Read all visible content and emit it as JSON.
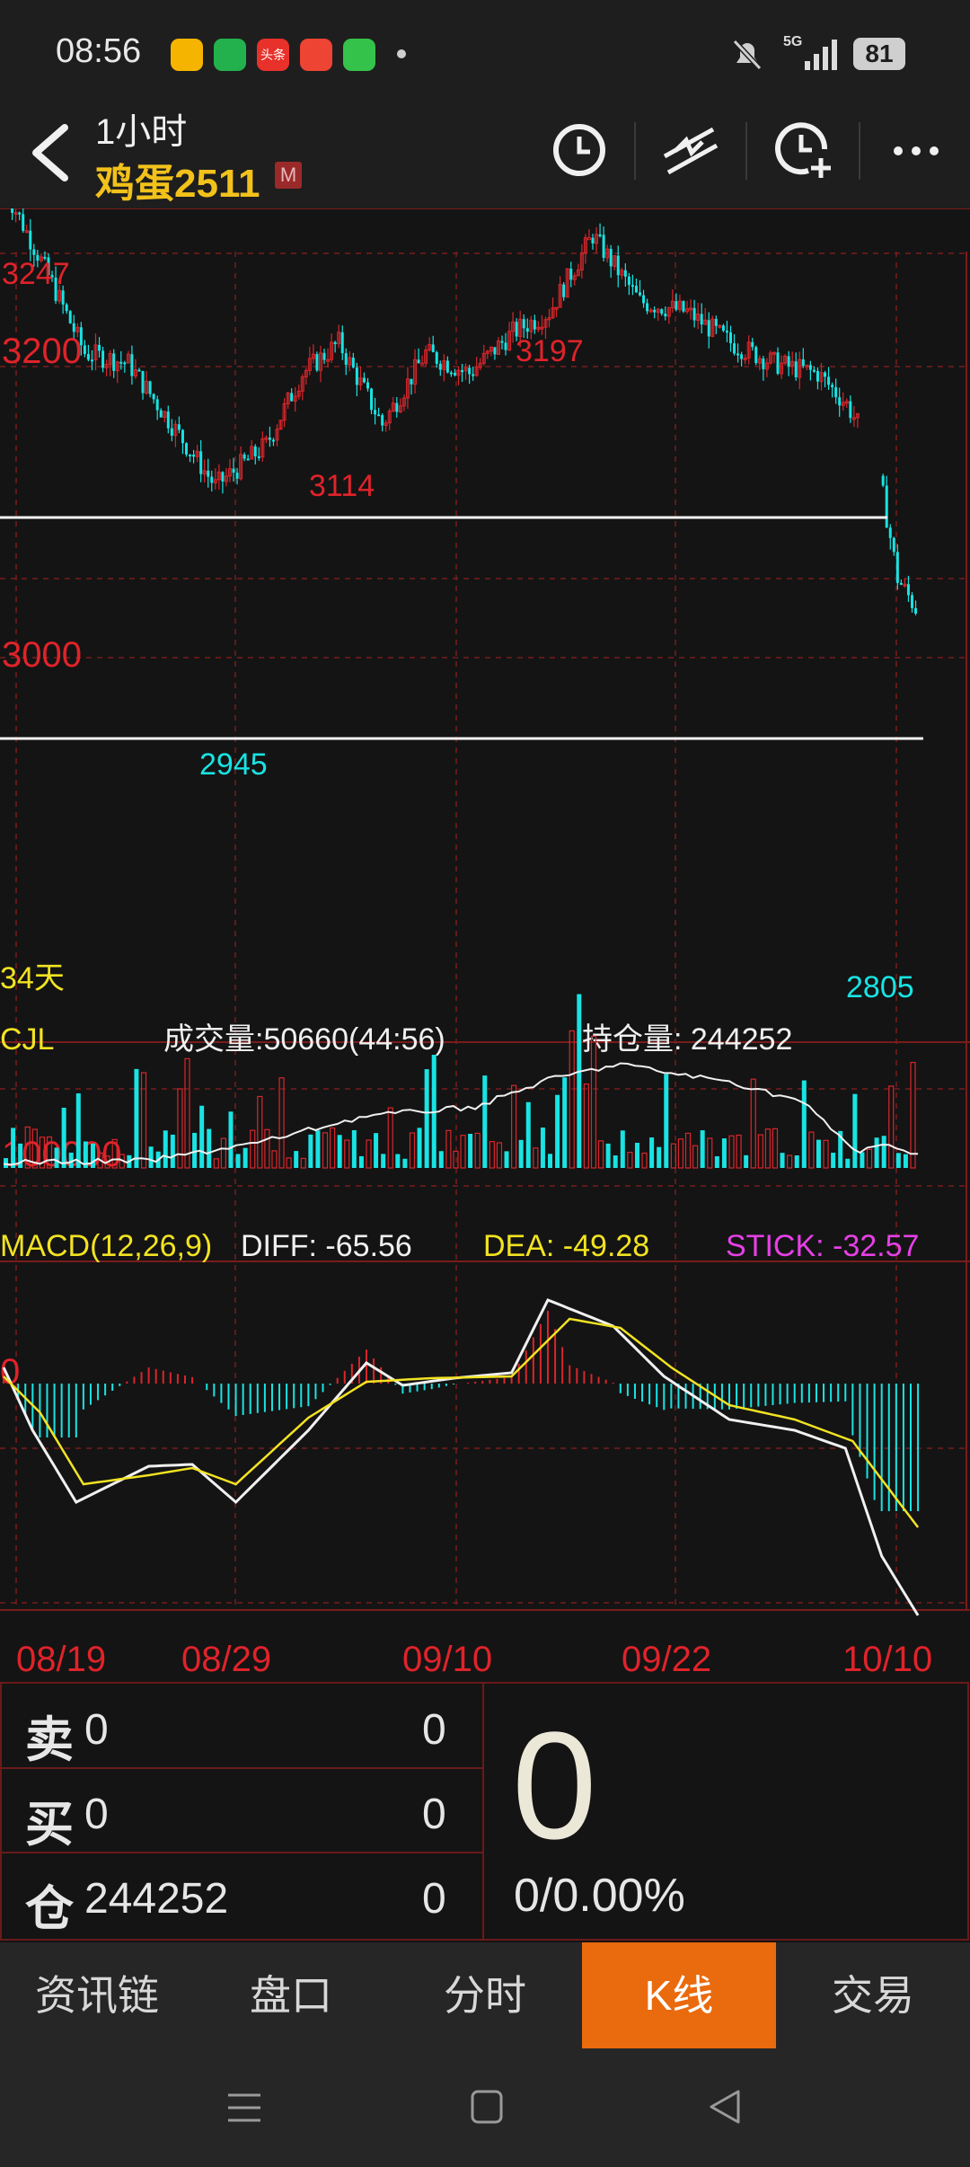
{
  "status_bar": {
    "time": "08:56",
    "network": "5G",
    "battery": "81",
    "apps": [
      {
        "name": "weibo-icon",
        "color": "#f5b400"
      },
      {
        "name": "message-icon",
        "color": "#22b14c"
      },
      {
        "name": "toutiao-icon",
        "color": "#e8312a",
        "label": "头条"
      },
      {
        "name": "video-icon",
        "color": "#ee4433"
      },
      {
        "name": "wechat-work-icon",
        "color": "#35c24a"
      }
    ]
  },
  "header": {
    "period": "1小时",
    "symbol": "鸡蛋2511",
    "badge": "M",
    "icons": [
      "clock-icon",
      "draw-line-icon",
      "add-alert-icon",
      "more-icon"
    ]
  },
  "chart": {
    "price_labels": {
      "high": "3247",
      "p3200": "3200",
      "p3000": "3000"
    },
    "annotations": {
      "a3197": "3197",
      "a3114": "3114",
      "a2945": "2945",
      "a2805": "2805"
    },
    "days": "34天",
    "volume_header": {
      "name": "CJL",
      "volume": "成交量:50660(44:56)",
      "open_interest": "持仓量: 244252",
      "scale": "100000"
    },
    "macd_header": {
      "name": "MACD(12,26,9)",
      "diff": "DIFF: -65.56",
      "dea": "DEA: -49.28",
      "stick": "STICK: -32.57",
      "zero": "0"
    },
    "dates": [
      "08/19",
      "08/29",
      "09/10",
      "09/22",
      "10/10"
    ],
    "colors": {
      "up": "#d8262b",
      "down": "#19e3e3",
      "grid": "#7a1c1c",
      "dea": "#f2e322",
      "stick": "#e640e6"
    }
  },
  "chart_data": {
    "type": "candlestick",
    "y_ticks": [
      3000,
      3200
    ],
    "price_extremes": {
      "high": 3247,
      "low": 2805
    },
    "marked_points": [
      3247,
      3197,
      3114,
      2945,
      2805
    ],
    "support_resistance": [
      3100,
      2965
    ],
    "x": [
      "08/19",
      "08/29",
      "09/10",
      "09/22",
      "10/10"
    ],
    "volume": 50660,
    "open_interest": 244252,
    "macd": {
      "diff": -65.56,
      "dea": -49.28,
      "stick": -32.57
    }
  },
  "order_book": {
    "sell": {
      "label": "卖",
      "price": "0",
      "qty": "0"
    },
    "buy": {
      "label": "买",
      "price": "0",
      "qty": "0"
    },
    "position": {
      "label": "仓",
      "value": "244252",
      "qty": "0"
    },
    "last_price": "0",
    "change": "0/0.00%"
  },
  "tabs": [
    {
      "label": "资讯链",
      "active": false
    },
    {
      "label": "盘口",
      "active": false
    },
    {
      "label": "分时",
      "active": false
    },
    {
      "label": "K线",
      "active": true
    },
    {
      "label": "交易",
      "active": false
    }
  ]
}
